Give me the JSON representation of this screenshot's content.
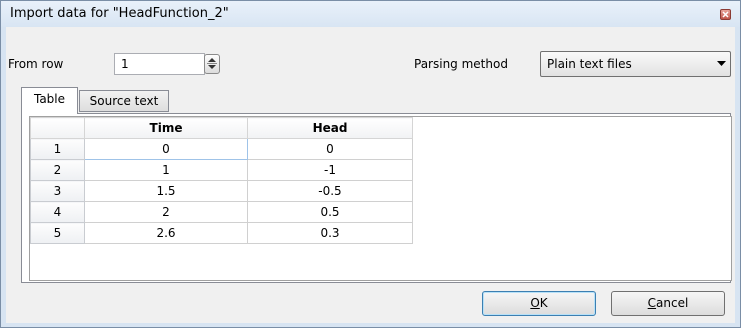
{
  "window": {
    "title": "Import data for \"HeadFunction_2\""
  },
  "from_row": {
    "label": "From row",
    "value": "1"
  },
  "parsing": {
    "label": "Parsing method",
    "selected": "Plain text files"
  },
  "tabs": [
    {
      "label": "Table",
      "active": true
    },
    {
      "label": "Source text",
      "active": false
    }
  ],
  "table": {
    "columns": [
      "Time",
      "Head"
    ],
    "rows": [
      {
        "n": "1",
        "time": "0",
        "head": "0"
      },
      {
        "n": "2",
        "time": "1",
        "head": "-1"
      },
      {
        "n": "3",
        "time": "1.5",
        "head": "-0.5"
      },
      {
        "n": "4",
        "time": "2",
        "head": "0.5"
      },
      {
        "n": "5",
        "time": "2.6",
        "head": "0.3"
      }
    ]
  },
  "buttons": {
    "ok_mnemonic": "O",
    "ok_rest": "K",
    "cancel_mnemonic": "C",
    "cancel_rest": "ancel"
  },
  "icons": {
    "close": "close-icon",
    "spinner": "spinner-icon",
    "dropdown": "chevron-down-icon"
  }
}
